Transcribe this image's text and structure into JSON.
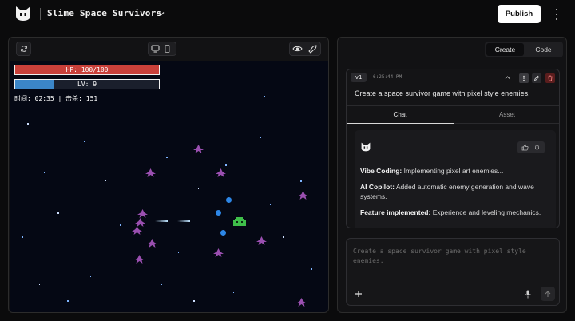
{
  "header": {
    "app_title": "Slime Space Survivors",
    "publish_label": "Publish",
    "icons": [
      "cat-logo-icon",
      "chevron-down-icon",
      "more-vertical-icon"
    ]
  },
  "preview_toolbar": {
    "icons": [
      "refresh-icon",
      "desktop-icon",
      "mobile-icon",
      "eye-icon",
      "rocket-icon"
    ]
  },
  "game": {
    "hp_label": "HP: 100/100",
    "hp_fraction": 1.0,
    "lv_label": "LV: 9",
    "lv_progress": 0.27,
    "stats_text": "时间: 02:35 | 击杀: 151",
    "colors": {
      "background": "#050814",
      "enemy": "#9a4fb0",
      "player": "#3fbf4a",
      "bullet": "#2d86e6",
      "hp": "#c9403a",
      "xp": "#3b86c8"
    }
  },
  "right_panel": {
    "mode_tabs": {
      "create": "Create",
      "code": "Code"
    },
    "version": {
      "badge": "v1",
      "time": "6:25:44 PM",
      "title": "Create a space survivor game with pixel style enemies.",
      "icons": [
        "chevron-up-icon",
        "more-icon",
        "edit-icon",
        "delete-icon"
      ]
    },
    "tabs": {
      "chat": "Chat",
      "asset": "Asset"
    },
    "message": {
      "avatar_icon": "cat-logo-icon",
      "feedback_icons": [
        "thumbs-up-icon",
        "bell-icon"
      ],
      "lines": [
        {
          "label": "Vibe Coding:",
          "text": " Implementing pixel art enemies..."
        },
        {
          "label": "AI Copilot:",
          "text": " Added automatic enemy generation and wave systems."
        },
        {
          "label": "Feature implemented:",
          "text": " Experience and leveling mechanics."
        }
      ]
    },
    "input": {
      "placeholder": "Create a space survivor game with pixel style enemies.",
      "icons": [
        "plus-icon",
        "microphone-icon",
        "send-arrow-icon"
      ]
    }
  }
}
